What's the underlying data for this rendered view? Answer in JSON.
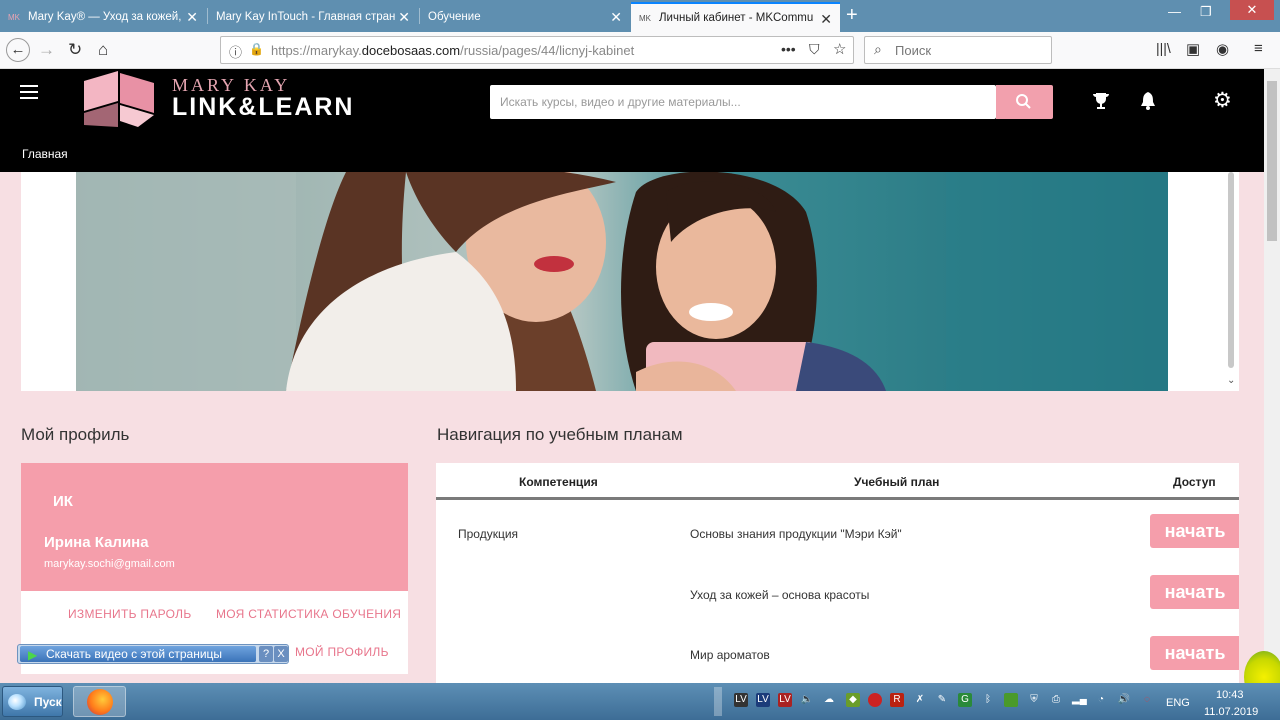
{
  "browser": {
    "tabs": [
      {
        "favicon": "MK",
        "title": "Mary Kay® — Уход за кожей, ",
        "active": false
      },
      {
        "favicon": "",
        "title": "Mary Kay InTouch - Главная стран",
        "active": false
      },
      {
        "favicon": "",
        "title": "Обучение",
        "active": false
      },
      {
        "favicon": "MK",
        "title": "Личный кабинет - MKCommu",
        "active": true
      }
    ],
    "url_prefix": "https://marykay.",
    "url_domain": "docebosaas.com",
    "url_path": "/russia/pages/44/licnyj-kabinet",
    "search_placeholder": "Поиск"
  },
  "site": {
    "logo_top": "MARY KAY",
    "logo_main": "LINK&LEARN",
    "search_placeholder": "Искать курсы, видео и другие материалы...",
    "nav_home": "Главная",
    "accent": "#f59eab"
  },
  "profile": {
    "section_title": "Мой профиль",
    "initials": "ИК",
    "name": "Ирина Калина",
    "email": "marykay.sochi@gmail.com",
    "change_password": "ИЗМЕНИТЬ ПАРОЛЬ",
    "my_stats": "МОЯ СТАТИСТИКА ОБУЧЕНИЯ",
    "my_profile": "МОЙ ПРОФИЛЬ"
  },
  "plans": {
    "section_title": "Навигация по учебным планам",
    "columns": [
      "Компетенция",
      "Учебный план",
      "Доступ"
    ],
    "rows": [
      {
        "competence": "Продукция",
        "plan": "Основы знания продукции \"Мэри Кэй\"",
        "action": "начать"
      },
      {
        "competence": "",
        "plan": "Уход за кожей – основа красоты",
        "action": "начать"
      },
      {
        "competence": "",
        "plan": "Мир ароматов",
        "action": "начать"
      }
    ]
  },
  "download_widget": {
    "label": "Скачать видео с этой страницы",
    "help": "?",
    "close": "X"
  },
  "taskbar": {
    "start": "Пуск",
    "lang": "ENG",
    "time": "10:43",
    "date": "11.07.2019"
  }
}
